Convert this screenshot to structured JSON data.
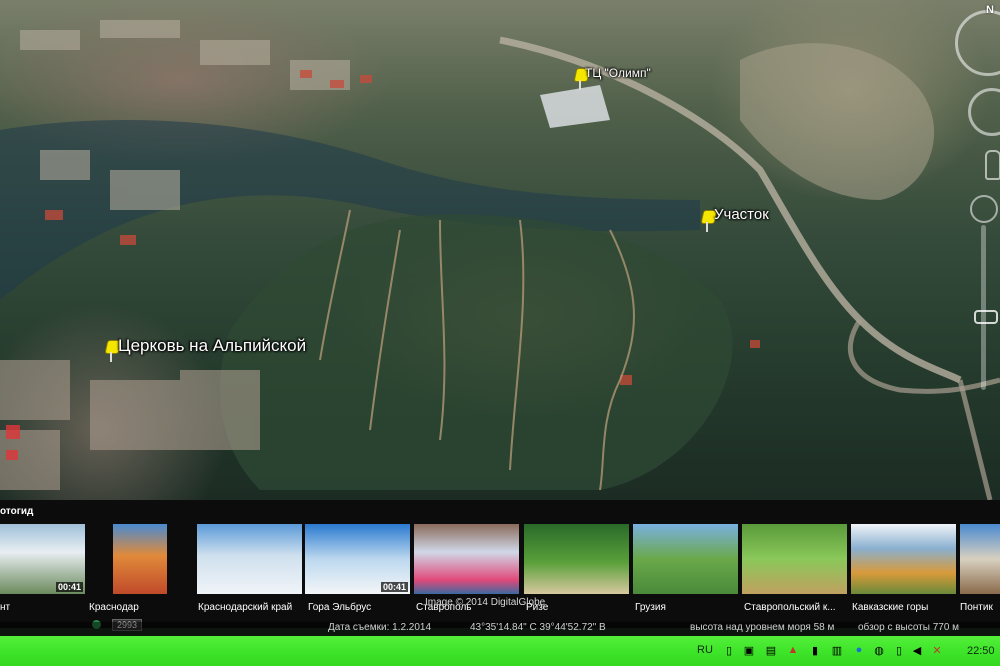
{
  "map": {
    "placemarks": [
      {
        "label": "ТЦ \"Олимп\""
      },
      {
        "label": "Участок"
      },
      {
        "label": "Церковь на Альпийской"
      }
    ],
    "compass_letter": "N"
  },
  "photo_strip": {
    "title": "отогид",
    "copyright": "Image © 2014 DigitalGlobe",
    "count_badge": "2993",
    "thumbnails": [
      {
        "label": "нт",
        "duration": "00:41"
      },
      {
        "label": "Краснодар",
        "duration": ""
      },
      {
        "label": "Краснодарский край",
        "duration": ""
      },
      {
        "label": "Гора Эльбрус",
        "duration": "00:41"
      },
      {
        "label": "Ставрополь",
        "duration": ""
      },
      {
        "label": "Ризе",
        "duration": ""
      },
      {
        "label": "Грузия",
        "duration": ""
      },
      {
        "label": "Ставропольский к...",
        "duration": ""
      },
      {
        "label": "Кавказские горы",
        "duration": ""
      },
      {
        "label": "Понтик",
        "duration": ""
      }
    ]
  },
  "status_bar": {
    "date": "Дата съемки: 1.2.2014",
    "coords": "43°35'14.84\" С  39°44'52.72\" В",
    "elevation": "высота над уровнем моря    58 м",
    "eye_alt": "обзор с высоты    770 м"
  },
  "taskbar": {
    "language": "RU",
    "time": "22:50"
  },
  "colors": {
    "taskbar": "#3fe52a",
    "pin": "#f5e600"
  }
}
